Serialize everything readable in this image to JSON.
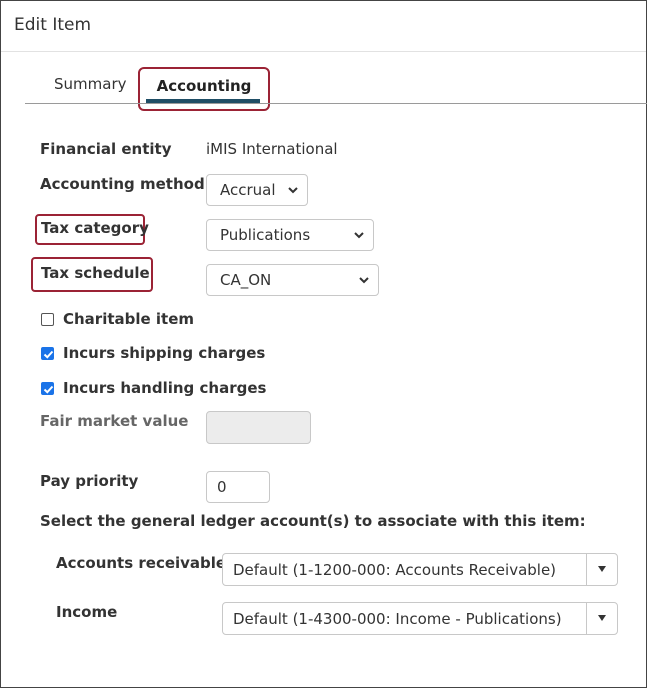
{
  "window": {
    "title": "Edit Item"
  },
  "tabs": [
    {
      "label": "Summary",
      "active": false
    },
    {
      "label": "Accounting",
      "active": true
    }
  ],
  "form": {
    "financial_entity": {
      "label": "Financial entity",
      "value": "iMIS International"
    },
    "accounting_method": {
      "label": "Accounting method",
      "value": "Accrual"
    },
    "tax_category": {
      "label": "Tax category",
      "value": "Publications"
    },
    "tax_schedule": {
      "label": "Tax schedule",
      "value": "CA_ON"
    },
    "charitable_item": {
      "label": "Charitable item",
      "checked": false
    },
    "incurs_shipping": {
      "label": "Incurs shipping charges",
      "checked": true
    },
    "incurs_handling": {
      "label": "Incurs handling charges",
      "checked": true
    },
    "fair_market_value": {
      "label": "Fair market value",
      "value": ""
    },
    "pay_priority": {
      "label": "Pay priority",
      "value": "0"
    },
    "gl_section_text": "Select the general ledger account(s) to associate with this item:",
    "accounts_receivable": {
      "label": "Accounts receivable",
      "value": "Default (1-1200-000: Accounts Receivable)"
    },
    "income": {
      "label": "Income",
      "value": "Default (1-4300-000: Income - Publications)"
    }
  },
  "colors": {
    "highlight": "#9b2335",
    "tab_underline": "#1f4e66",
    "checkbox_checked": "#1a73e8"
  }
}
